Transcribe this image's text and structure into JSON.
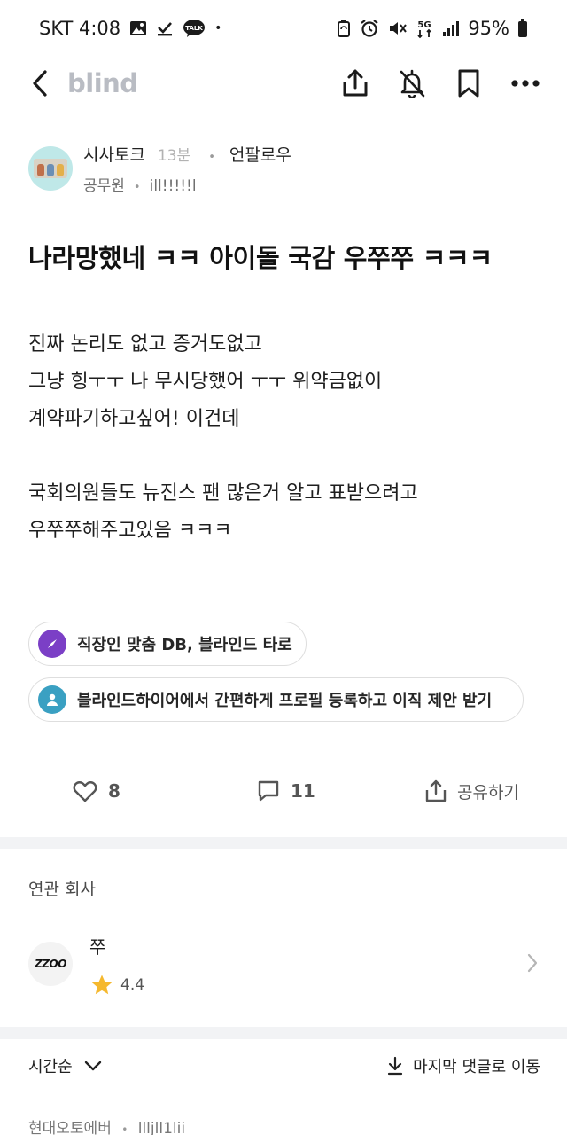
{
  "status_bar": {
    "carrier_time": "SKT 4:08",
    "dot": "•",
    "battery": "95%",
    "icons": [
      "gallery-icon",
      "check-icon",
      "talk-icon",
      "recycle-icon",
      "alarm-icon",
      "mute-icon",
      "5g-icon",
      "signal-icon",
      "battery-icon"
    ],
    "talk_text": "TALK",
    "net_text": "5G"
  },
  "topbar": {
    "logo": "blind",
    "icons": [
      "back-icon",
      "share-icon",
      "bell-off-icon",
      "bookmark-icon",
      "more-icon"
    ]
  },
  "post": {
    "author": {
      "name": "시사토크",
      "time": "13분",
      "dot": "•",
      "follow": "언팔로우",
      "company": "공무원",
      "sep": "•",
      "nick": "ill!!!!!l"
    },
    "title": "나라망했네 ㅋㅋ 아이돌 국감 우쭈쭈 ㅋㅋㅋ",
    "body": "진짜 논리도 없고 증거도없고\n그냥 힝ㅜㅜ 나 무시당했어 ㅜㅜ 위약금없이\n계약파기하고싶어! 이건데\n\n국회의원들도 뉴진스 팬 많은거 알고 표받으려고\n우쭈쭈해주고있음 ㅋㅋㅋ"
  },
  "chips": [
    {
      "label": "직장인 맞춤 DB, 블라인드 타로",
      "icon": "compass-icon",
      "color": "#7b3fc6"
    },
    {
      "label": "블라인드하이어에서 간편하게 프로필 등록하고 이직 제안 받기",
      "icon": "person-icon",
      "color": "#3aa0c2"
    }
  ],
  "actions": {
    "likes": "8",
    "comments": "11",
    "share": "공유하기"
  },
  "related": {
    "section_title": "연관 회사",
    "company_name": "쭈",
    "company_logo_text": "ZZOO",
    "rating": "4.4",
    "star_color": "#f5b82e"
  },
  "sort": {
    "label": "시간순",
    "jump": "마지막 댓글로 이동"
  },
  "comment_peek": {
    "company": "현대오토에버",
    "sep": "•",
    "nick": "llljll1lii"
  }
}
